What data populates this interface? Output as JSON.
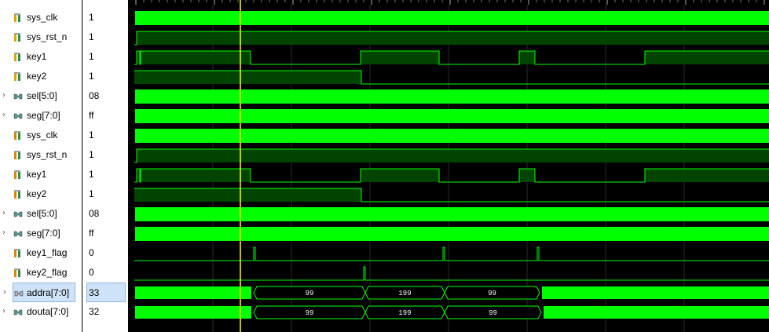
{
  "signals": [
    {
      "name": "sys_clk",
      "value": "1",
      "icon": "logic-signal-icon",
      "group": "input",
      "expandable": false
    },
    {
      "name": "sys_rst_n",
      "value": "1",
      "icon": "logic-signal-icon",
      "group": "input",
      "expandable": false
    },
    {
      "name": "key1",
      "value": "1",
      "icon": "logic-signal-icon",
      "group": "input",
      "expandable": false
    },
    {
      "name": "key2",
      "value": "1",
      "icon": "logic-signal-icon",
      "group": "input",
      "expandable": false
    },
    {
      "name": "sel[5:0]",
      "value": "08",
      "icon": "bus-signal-icon",
      "group": "input",
      "expandable": true
    },
    {
      "name": "seg[7:0]",
      "value": "ff",
      "icon": "bus-signal-icon",
      "group": "input",
      "expandable": true
    },
    {
      "name": "sys_clk",
      "value": "1",
      "icon": "logic-signal-icon",
      "group": "internal",
      "expandable": false
    },
    {
      "name": "sys_rst_n",
      "value": "1",
      "icon": "logic-signal-icon",
      "group": "internal",
      "expandable": false
    },
    {
      "name": "key1",
      "value": "1",
      "icon": "logic-signal-icon",
      "group": "internal",
      "expandable": false
    },
    {
      "name": "key2",
      "value": "1",
      "icon": "logic-signal-icon",
      "group": "internal",
      "expandable": false
    },
    {
      "name": "sel[5:0]",
      "value": "08",
      "icon": "bus-signal-icon",
      "group": "internal",
      "expandable": true
    },
    {
      "name": "seg[7:0]",
      "value": "ff",
      "icon": "bus-signal-icon",
      "group": "internal",
      "expandable": true
    },
    {
      "name": "key1_flag",
      "value": "0",
      "icon": "logic-signal-icon",
      "group": "internal",
      "expandable": false
    },
    {
      "name": "key2_flag",
      "value": "0",
      "icon": "logic-signal-icon",
      "group": "internal",
      "expandable": false
    },
    {
      "name": "addra[7:0]",
      "value": "33",
      "icon": "bus-signal-icon",
      "group": "selected",
      "expandable": true,
      "selected": true
    },
    {
      "name": "douta[7:0]",
      "value": "32",
      "icon": "bus-signal-icon",
      "group": "internal",
      "expandable": true
    }
  ],
  "bus_labels": {
    "addra": [
      "99",
      "199",
      "99"
    ],
    "douta": [
      "99",
      "199",
      "99"
    ]
  },
  "colors": {
    "wave_green": "#00ff00",
    "wave_dark_green": "#004400",
    "cursor": "#ffff00",
    "grid": "#2a2a2a",
    "selection": "#cfe3f8"
  }
}
